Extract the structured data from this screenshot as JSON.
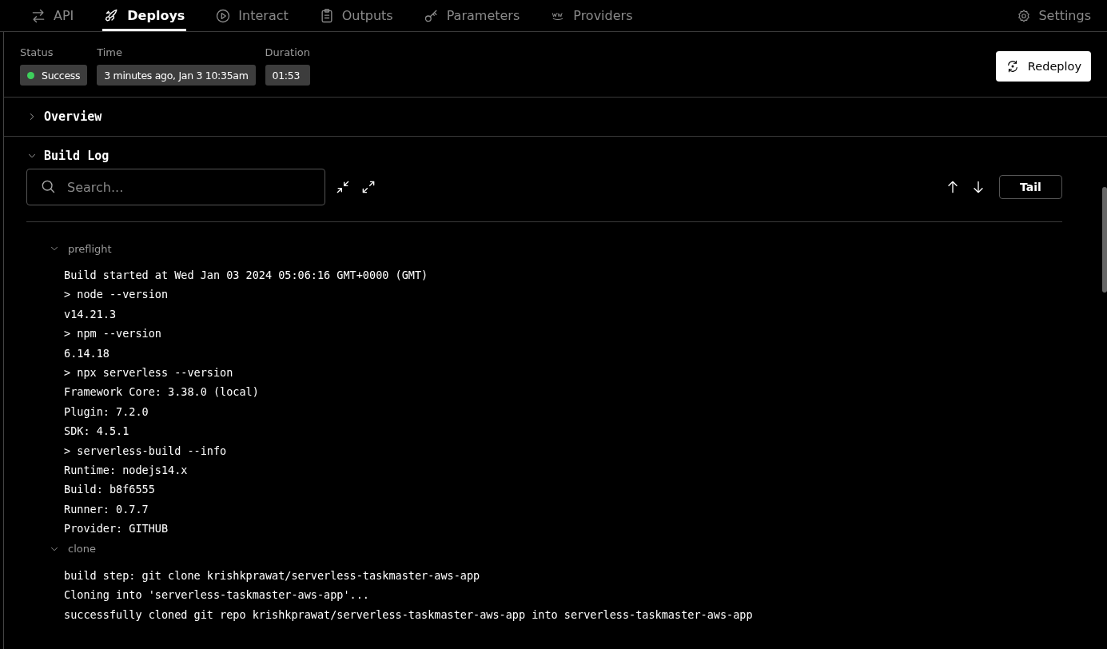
{
  "tabs": [
    {
      "label": "API",
      "kind": "arrows",
      "selected": false
    },
    {
      "label": "Deploys",
      "kind": "rocket",
      "selected": true
    },
    {
      "label": "Interact",
      "kind": "play",
      "selected": false
    },
    {
      "label": "Outputs",
      "kind": "clipboard",
      "selected": false
    },
    {
      "label": "Parameters",
      "kind": "key",
      "selected": false
    },
    {
      "label": "Providers",
      "kind": "aws",
      "selected": false
    }
  ],
  "settings": {
    "label": "Settings"
  },
  "deploy": {
    "status_label": "Status",
    "status": "Success",
    "time_label": "Time",
    "time": "3 minutes ago, Jan 3 10:35am",
    "duration_label": "Duration",
    "duration": "01:53",
    "redeploy": "Redeploy"
  },
  "sections": [
    {
      "title": "Overview",
      "expanded": false
    },
    {
      "title": "Build Log",
      "expanded": true
    }
  ],
  "build_log": {
    "search": {
      "placeholder": "Search..."
    },
    "tail": "Tail",
    "groups": [
      {
        "name": "preflight",
        "expanded": true,
        "lines": [
          "Build started at Wed Jan 03 2024 05:06:16 GMT+0000 (GMT)",
          "> node --version",
          "v14.21.3",
          "> npm --version",
          "6.14.18",
          "> npx serverless --version",
          "Framework Core: 3.38.0 (local)",
          "Plugin: 7.2.0",
          "SDK: 4.5.1",
          "> serverless-build --info",
          "Runtime: nodejs14.x",
          "Build: b8f6555",
          "Runner: 0.7.7",
          "Provider: GITHUB"
        ]
      },
      {
        "name": "clone",
        "expanded": true,
        "lines": [
          "build step: git clone krishkprawat/serverless-taskmaster-aws-app",
          "Cloning into 'serverless-taskmaster-aws-app'...",
          "successfully cloned git repo krishkprawat/serverless-taskmaster-aws-app into serverless-taskmaster-aws-app"
        ]
      }
    ]
  }
}
